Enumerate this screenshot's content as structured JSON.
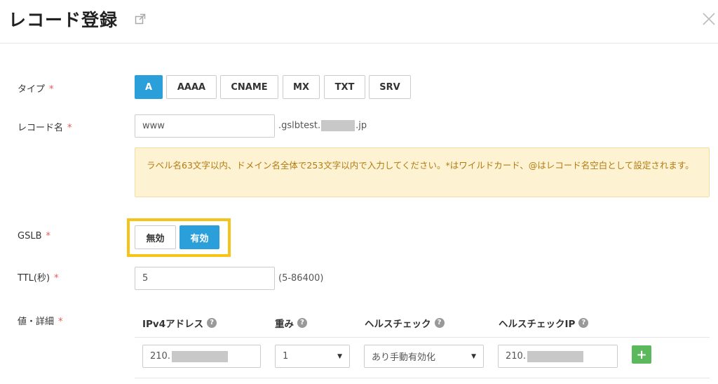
{
  "header": {
    "title": "レコード登録"
  },
  "form": {
    "type": {
      "label": "タイプ",
      "required": "*",
      "options": [
        "A",
        "AAAA",
        "CNAME",
        "MX",
        "TXT",
        "SRV"
      ],
      "selected": "A"
    },
    "record_name": {
      "label": "レコード名",
      "required": "*",
      "value": "www",
      "suffix_prefix": ".gslbtest.",
      "suffix_tld": ".jp"
    },
    "notice": "ラベル名63文字以内、ドメイン名全体で253文字以内で入力してください。*はワイルドカード、@はレコード名空白として設定されます。",
    "gslb": {
      "label": "GSLB",
      "required": "*",
      "off_label": "無効",
      "on_label": "有効",
      "selected": "有効"
    },
    "ttl": {
      "label": "TTL(秒)",
      "required": "*",
      "value": "5",
      "range": "(5-86400)"
    },
    "details": {
      "label": "値・詳細",
      "required": "*",
      "columns": [
        "IPv4アドレス",
        "重み",
        "ヘルスチェック",
        "ヘルスチェックIP"
      ],
      "row": {
        "ipv4": "210.",
        "weight": "1",
        "healthcheck": "あり手動有効化",
        "healthcheck_ip": "210."
      },
      "add_label": "+"
    }
  },
  "colors": {
    "accent": "#2b9fd9",
    "highlight": "#f6c318",
    "add": "#5cb85c"
  }
}
